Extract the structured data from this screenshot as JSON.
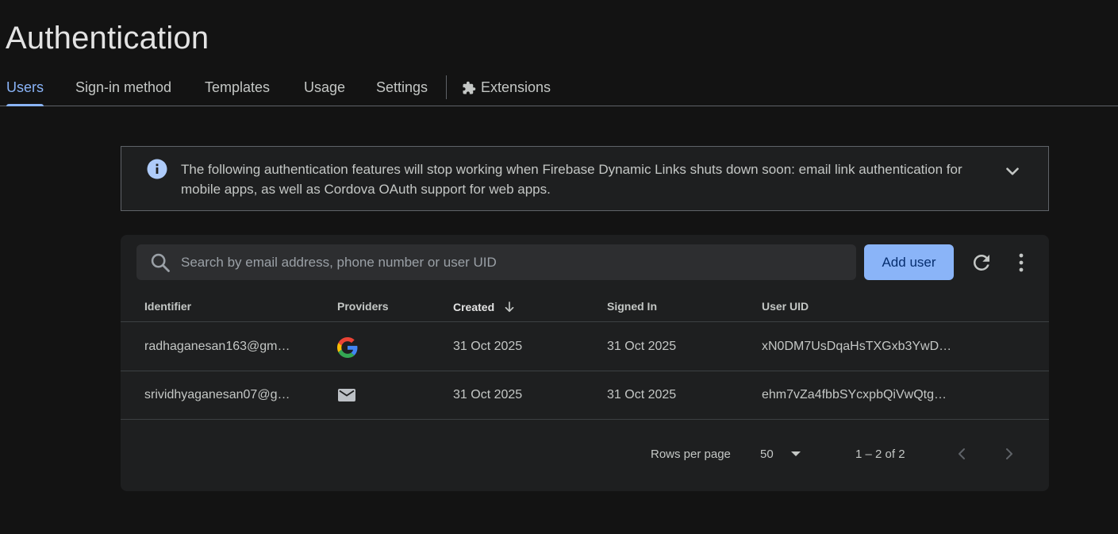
{
  "page": {
    "title": "Authentication"
  },
  "tabs": [
    {
      "label": "Users",
      "active": true
    },
    {
      "label": "Sign-in method",
      "active": false
    },
    {
      "label": "Templates",
      "active": false
    },
    {
      "label": "Usage",
      "active": false
    },
    {
      "label": "Settings",
      "active": false
    },
    {
      "label": "Extensions",
      "active": false,
      "icon": "extension-puzzle-icon"
    }
  ],
  "notice": {
    "icon": "info-icon",
    "text": "The following authentication features will stop working when Firebase Dynamic Links shuts down soon: email link authentication for mobile apps, as well as Cordova OAuth support for web apps.",
    "expand_icon": "chevron-down-icon"
  },
  "toolbar": {
    "search_placeholder": "Search by email address, phone number or user UID",
    "add_user_label": "Add user",
    "refresh_icon": "refresh-icon",
    "more_icon": "more-vert-icon"
  },
  "table": {
    "headers": {
      "identifier": "Identifier",
      "providers": "Providers",
      "created": "Created",
      "signed_in": "Signed In",
      "user_uid": "User UID"
    },
    "sort": {
      "column": "created",
      "direction": "descending"
    },
    "rows": [
      {
        "identifier": "radhaganesan163@gm…",
        "provider": "google-icon",
        "created": "31 Oct 2025",
        "signed_in": "31 Oct 2025",
        "user_uid": "xN0DM7UsDqaHsTXGxb3YwD…"
      },
      {
        "identifier": "srividhyaganesan07@g…",
        "provider": "email-icon",
        "created": "31 Oct 2025",
        "signed_in": "31 Oct 2025",
        "user_uid": "ehm7vZa4fbbSYcxpbQiVwQtg…"
      }
    ]
  },
  "pagination": {
    "rows_per_page_label": "Rows per page",
    "rows_per_page_value": "50",
    "range": "1 – 2 of 2"
  },
  "colors": {
    "background": "#131313",
    "surface": "#1e1f20",
    "accent": "#8ab4f8",
    "button_text": "#062e6f"
  }
}
